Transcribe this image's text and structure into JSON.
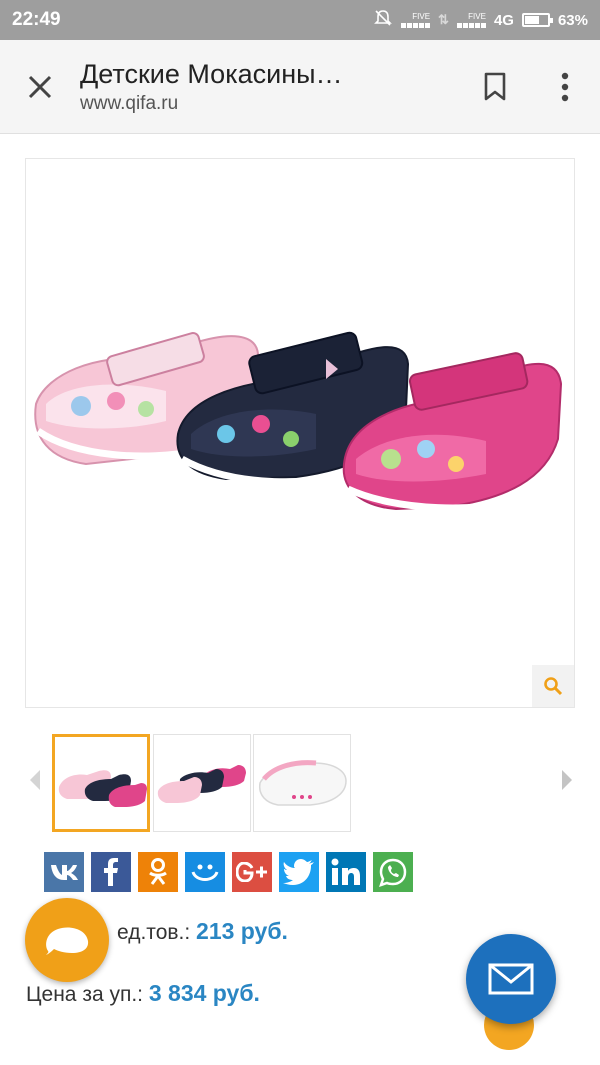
{
  "status_bar": {
    "time": "22:49",
    "sim1_label": "FIVE",
    "sim2_label": "FIVE",
    "network": "4G",
    "battery": "63%"
  },
  "toolbar": {
    "title": "Детские Мокасины…",
    "url": "www.qifa.ru"
  },
  "gallery": {
    "thumbnail_count": 3,
    "active_index": 0
  },
  "social": [
    {
      "name": "vk",
      "glyph": "vk",
      "color": "#4a76a8"
    },
    {
      "name": "facebook",
      "glyph": "f",
      "color": "#3b5998"
    },
    {
      "name": "odnoklassniki",
      "glyph": "ok",
      "color": "#ee8208"
    },
    {
      "name": "moimir",
      "glyph": "mm",
      "color": "#168de2"
    },
    {
      "name": "googleplus",
      "glyph": "G+",
      "color": "#dc4e41"
    },
    {
      "name": "twitter",
      "glyph": "tw",
      "color": "#1da1f2"
    },
    {
      "name": "linkedin",
      "glyph": "in",
      "color": "#0077b5"
    },
    {
      "name": "whatsapp",
      "glyph": "wa",
      "color": "#4caf50"
    }
  ],
  "prices": {
    "unit_label": "ед.тов.:",
    "unit_value": "213 руб.",
    "pack_label": "Цена за уп.:",
    "pack_value": "3 834 руб."
  },
  "colors": {
    "accent": "#f3a622",
    "price": "#2a86c3",
    "mail_fab": "#1d70bd"
  }
}
